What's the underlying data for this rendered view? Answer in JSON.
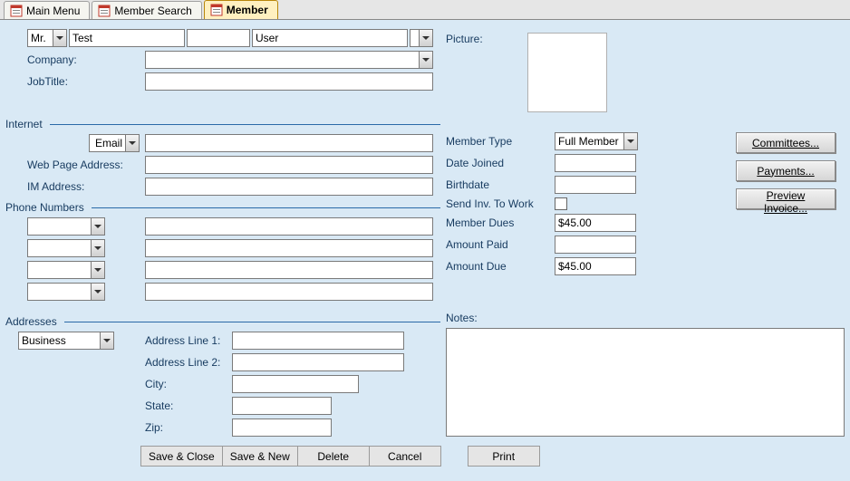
{
  "tabs": {
    "t0": "Main Menu",
    "t1": "Member Search",
    "t2": "Member"
  },
  "name": {
    "prefix": "Mr.",
    "first": "Test",
    "middle": "",
    "last": "User",
    "suffix": ""
  },
  "labels": {
    "company": "Company:",
    "jobtitle": "JobTitle:",
    "picture": "Picture:",
    "internet": "Internet",
    "emailType": "Email",
    "webpage": "Web Page Address:",
    "im": "IM Address:",
    "phones": "Phone Numbers",
    "memberType": "Member Type",
    "dateJoined": "Date Joined",
    "birthdate": "Birthdate",
    "sendInv": "Send Inv. To Work",
    "memberDues": "Member Dues",
    "amountPaid": "Amount Paid",
    "amountDue": "Amount Due",
    "addresses": "Addresses",
    "notes": "Notes:",
    "addr1": "Address Line 1:",
    "addr2": "Address Line 2:",
    "city": "City:",
    "state": "State:",
    "zip": "Zip:",
    "addressType": "Business"
  },
  "values": {
    "company": "",
    "jobtitle": "",
    "email": "",
    "webpage": "",
    "im": "",
    "phone1": "",
    "phone1label": "",
    "phone2": "",
    "phone2label": "",
    "phone3": "",
    "phone3label": "",
    "phone4": "",
    "phone4label": "",
    "memberType": "Full Member",
    "dateJoined": "",
    "birthdate": "",
    "memberDues": "$45.00",
    "amountPaid": "",
    "amountDue": "$45.00",
    "addr1": "",
    "addr2": "",
    "city": "",
    "state": "",
    "zip": "",
    "notes": ""
  },
  "buttons": {
    "committees": "Committees...",
    "payments": "Payments...",
    "preview": "Preview Invoice...",
    "saveClose": "Save & Close",
    "saveNew": "Save & New",
    "delete": "Delete",
    "cancel": "Cancel",
    "print": "Print"
  }
}
